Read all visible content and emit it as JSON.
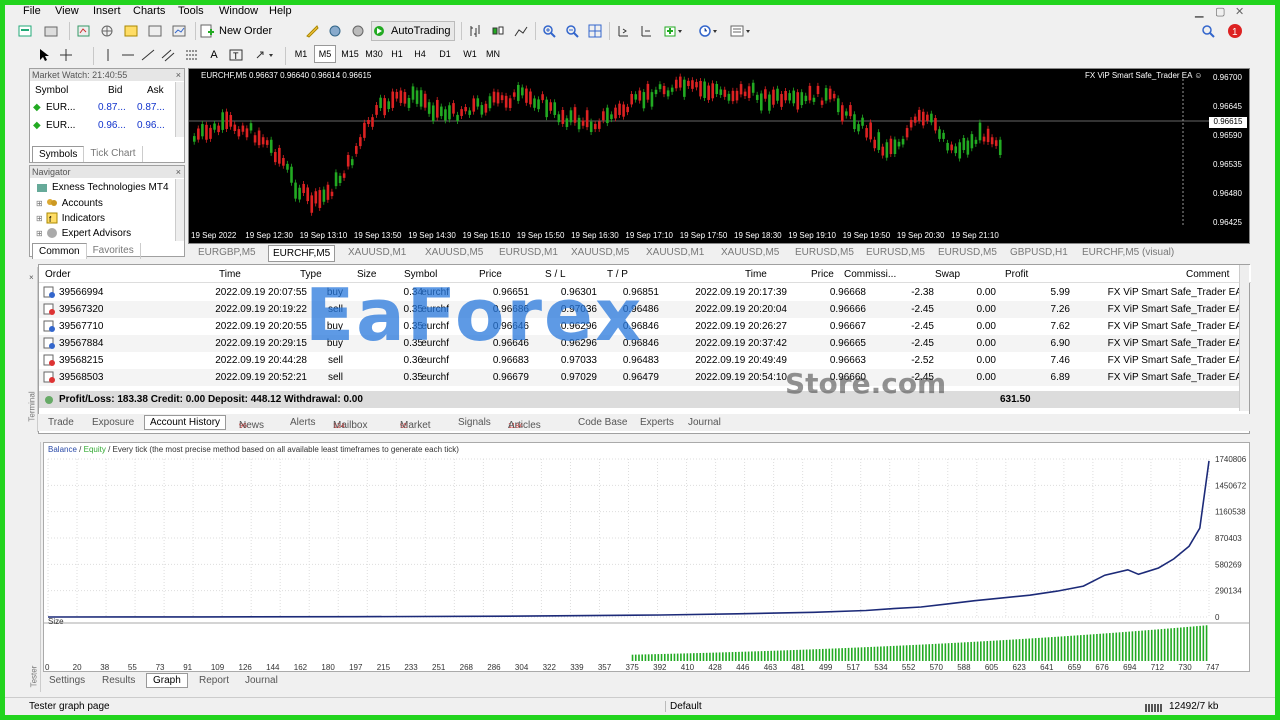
{
  "menu": [
    "File",
    "View",
    "Insert",
    "Charts",
    "Tools",
    "Window",
    "Help"
  ],
  "toolbar": {
    "new_order": "New Order",
    "autotrading": "AutoTrading"
  },
  "timeframes": [
    "M1",
    "M5",
    "M15",
    "M30",
    "H1",
    "H4",
    "D1",
    "W1",
    "MN"
  ],
  "market_watch": {
    "title": "Market Watch: 21:40:55",
    "headers": [
      "Symbol",
      "Bid",
      "Ask"
    ],
    "rows": [
      [
        "EUR...",
        "0.87...",
        "0.87..."
      ],
      [
        "EUR...",
        "0.96...",
        "0.96..."
      ]
    ],
    "tabs": [
      "Symbols",
      "Tick Chart"
    ]
  },
  "navigator": {
    "title": "Navigator",
    "items": [
      "Exness Technologies MT4",
      "Accounts",
      "Indicators",
      "Expert Advisors"
    ],
    "tabs": [
      "Common",
      "Favorites"
    ]
  },
  "chart": {
    "header": "EURCHF,M5  0.96637 0.96640 0.96614 0.96615",
    "ea_label": "FX ViP Smart Safe_Trader EA ☺",
    "current_price": "0.96615",
    "price_ticks": [
      "0.96700",
      "0.96645",
      "0.96590",
      "0.96535",
      "0.96480",
      "0.96425"
    ],
    "time_ticks": [
      "19 Sep 2022",
      "19 Sep 12:30",
      "19 Sep 13:10",
      "19 Sep 13:50",
      "19 Sep 14:30",
      "19 Sep 15:10",
      "19 Sep 15:50",
      "19 Sep 16:30",
      "19 Sep 17:10",
      "19 Sep 17:50",
      "19 Sep 18:30",
      "19 Sep 19:10",
      "19 Sep 19:50",
      "19 Sep 20:30",
      "19 Sep 21:10"
    ],
    "tabs": [
      "EURGBP,M5",
      "EURCHF,M5",
      "XAUUSD,M1",
      "XAUUSD,M5",
      "EURUSD,M1",
      "XAUUSD,M5",
      "XAUUSD,M1",
      "XAUUSD,M5",
      "EURUSD,M5",
      "EURUSD,M5",
      "EURUSD,M5",
      "GBPUSD,H1",
      "EURCHF,M5 (visual)"
    ]
  },
  "terminal": {
    "headers": [
      "Order",
      "Time",
      "Type",
      "Size",
      "Symbol",
      "Price",
      "S / L",
      "T / P",
      "Time",
      "Price",
      "Commissi...",
      "Swap",
      "Profit",
      "Comment"
    ],
    "rows": [
      [
        "39566994",
        "2022.09.19 20:07:55",
        "buy",
        "0.34",
        "eurchf",
        "0.96651",
        "0.96301",
        "0.96851",
        "2022.09.19 20:17:39",
        "0.96668",
        "-2.38",
        "0.00",
        "5.99",
        "FX ViP Smart Safe_Trader EA"
      ],
      [
        "39567320",
        "2022.09.19 20:19:22",
        "sell",
        "0.35",
        "eurchf",
        "0.96686",
        "0.97036",
        "0.96486",
        "2022.09.19 20:20:04",
        "0.96666",
        "-2.45",
        "0.00",
        "7.26",
        "FX ViP Smart Safe_Trader EA"
      ],
      [
        "39567710",
        "2022.09.19 20:20:55",
        "buy",
        "0.35",
        "eurchf",
        "0.96646",
        "0.96296",
        "0.96846",
        "2022.09.19 20:26:27",
        "0.96667",
        "-2.45",
        "0.00",
        "7.62",
        "FX ViP Smart Safe_Trader EA"
      ],
      [
        "39567884",
        "2022.09.19 20:29:15",
        "buy",
        "0.35",
        "eurchf",
        "0.96646",
        "0.96296",
        "0.96846",
        "2022.09.19 20:37:42",
        "0.96665",
        "-2.45",
        "0.00",
        "6.90",
        "FX ViP Smart Safe_Trader EA"
      ],
      [
        "39568215",
        "2022.09.19 20:44:28",
        "sell",
        "0.36",
        "eurchf",
        "0.96683",
        "0.97033",
        "0.96483",
        "2022.09.19 20:49:49",
        "0.96663",
        "-2.52",
        "0.00",
        "7.46",
        "FX ViP Smart Safe_Trader EA"
      ],
      [
        "39568503",
        "2022.09.19 20:52:21",
        "sell",
        "0.35",
        "eurchf",
        "0.96679",
        "0.97029",
        "0.96479",
        "2022.09.19 20:54:10",
        "0.96660",
        "-2.45",
        "0.00",
        "6.89",
        "FX ViP Smart Safe_Trader EA"
      ]
    ],
    "summary": "Profit/Loss: 183.38  Credit: 0.00  Deposit: 448.12  Withdrawal: 0.00",
    "summary_total": "631.50",
    "tabs": [
      {
        "label": "Trade",
        "badge": ""
      },
      {
        "label": "Exposure",
        "badge": ""
      },
      {
        "label": "Account History",
        "badge": ""
      },
      {
        "label": "News",
        "badge": "96"
      },
      {
        "label": "Alerts",
        "badge": ""
      },
      {
        "label": "Mailbox",
        "badge": "124"
      },
      {
        "label": "Market",
        "badge": "95"
      },
      {
        "label": "Signals",
        "badge": ""
      },
      {
        "label": "Articles",
        "badge": "1184"
      },
      {
        "label": "Code Base",
        "badge": ""
      },
      {
        "label": "Experts",
        "badge": ""
      },
      {
        "label": "Journal",
        "badge": ""
      }
    ],
    "side_label": "Terminal"
  },
  "tester": {
    "legend_balance": "Balance",
    "legend_equity": "Equity",
    "legend_text": "/ Every tick (the most precise method based on all available least timeframes to generate each tick)",
    "size_label": "Size",
    "tabs": [
      "Settings",
      "Results",
      "Graph",
      "Report",
      "Journal"
    ],
    "side_label": "Tester"
  },
  "chart_data": {
    "type": "line",
    "title": "",
    "xlabel": "",
    "ylabel": "",
    "ylim": [
      0,
      1740806
    ],
    "y_ticks": [
      "1740806",
      "1450672",
      "1160538",
      "870403",
      "580269",
      "290134",
      "0"
    ],
    "x_ticks": [
      "0",
      "20",
      "38",
      "55",
      "73",
      "91",
      "109",
      "126",
      "144",
      "162",
      "180",
      "197",
      "215",
      "233",
      "251",
      "268",
      "286",
      "304",
      "322",
      "339",
      "357",
      "375",
      "392",
      "410",
      "428",
      "446",
      "463",
      "481",
      "499",
      "517",
      "534",
      "552",
      "570",
      "588",
      "605",
      "623",
      "641",
      "659",
      "676",
      "694",
      "712",
      "730",
      "747"
    ],
    "series": [
      {
        "name": "Balance",
        "x": [
          0,
          100,
          200,
          300,
          400,
          450,
          500,
          534,
          552,
          570,
          588,
          605,
          623,
          641,
          659,
          676,
          690,
          705,
          712,
          725,
          735,
          745,
          752,
          758
        ],
        "y": [
          448,
          1500,
          3500,
          9000,
          22000,
          35000,
          52000,
          72000,
          92000,
          110000,
          145000,
          180000,
          210000,
          240000,
          285000,
          340000,
          460000,
          520000,
          470000,
          540000,
          640000,
          780000,
          980000,
          1720000
        ]
      }
    ]
  },
  "status": {
    "left": "Tester graph page",
    "mid": "Default",
    "right": "12492/7 kb"
  },
  "watermark": {
    "main": "EaForex",
    "sub": "Store.com"
  }
}
